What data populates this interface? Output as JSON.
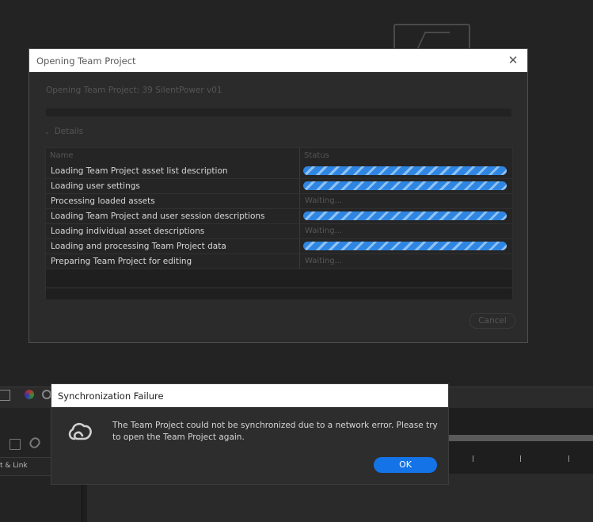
{
  "team_dialog": {
    "title": "Opening Team Project",
    "subtitle": "Opening Team Project: 39 SilentPower v01",
    "details_label": "Details",
    "columns": [
      "Name",
      "Status"
    ],
    "rows": [
      {
        "name": "Loading Team Project asset list description",
        "status": "in-progress"
      },
      {
        "name": "Loading user settings",
        "status": "in-progress"
      },
      {
        "name": "Processing loaded assets",
        "status": "Waiting..."
      },
      {
        "name": "Loading Team Project and user session descriptions",
        "status": "in-progress"
      },
      {
        "name": "Loading individual asset descriptions",
        "status": "Waiting..."
      },
      {
        "name": "Loading and processing Team Project data",
        "status": "in-progress"
      },
      {
        "name": "Preparing Team Project for editing",
        "status": "Waiting..."
      }
    ],
    "cancel_label": "Cancel"
  },
  "sync_dialog": {
    "title": "Synchronization Failure",
    "message": "The Team Project could not be synchronized due to a network error. Please try to open the Team Project again.",
    "ok_label": "OK"
  },
  "background": {
    "left_panel_label": "t & Link"
  },
  "colors": {
    "accent": "#1473e6",
    "progress_stripe": "#2f86e2",
    "dialog_bg": "#2b2b2b",
    "titlebar_bg": "#ffffff"
  }
}
